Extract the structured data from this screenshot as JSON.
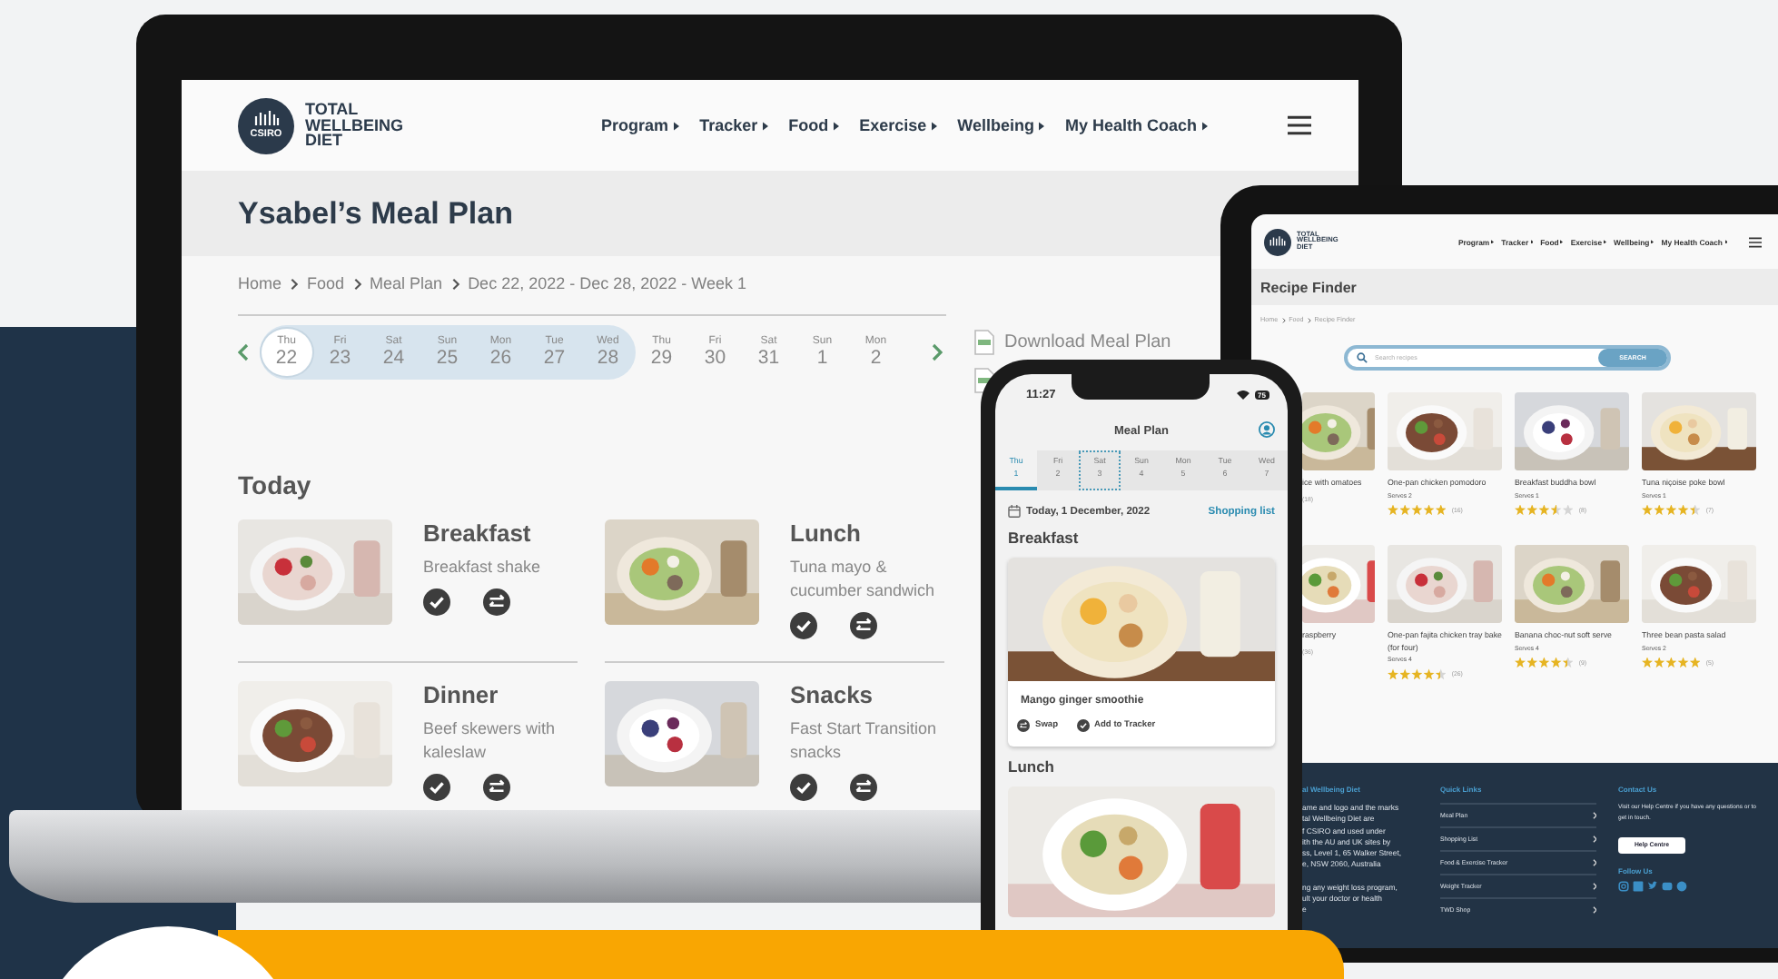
{
  "laptop": {
    "logo": {
      "badge": "CSIRO",
      "wordmark": [
        "TOTAL",
        "WELLBEING",
        "DIET"
      ]
    },
    "nav": [
      "Program",
      "Tracker",
      "Food",
      "Exercise",
      "Wellbeing",
      "My Health Coach"
    ],
    "title": "Ysabel’s Meal Plan",
    "breadcrumb": [
      "Home",
      "Food",
      "Meal Plan",
      "Dec 22, 2022 - Dec 28, 2022 - Week 1"
    ],
    "plan_week": [
      {
        "weekday": "Thu",
        "date": "22",
        "selected": true
      },
      {
        "weekday": "Fri",
        "date": "23",
        "selected": false
      },
      {
        "weekday": "Sat",
        "date": "24",
        "selected": false
      },
      {
        "weekday": "Sun",
        "date": "25",
        "selected": false
      },
      {
        "weekday": "Mon",
        "date": "26",
        "selected": false
      },
      {
        "weekday": "Tue",
        "date": "27",
        "selected": false
      },
      {
        "weekday": "Wed",
        "date": "28",
        "selected": false
      }
    ],
    "next_days": [
      {
        "weekday": "Thu",
        "date": "29",
        "selected": false
      },
      {
        "weekday": "Fri",
        "date": "30",
        "selected": false
      },
      {
        "weekday": "Sat",
        "date": "31",
        "selected": false
      },
      {
        "weekday": "Sun",
        "date": "1",
        "selected": false
      },
      {
        "weekday": "Mon",
        "date": "2",
        "selected": false
      }
    ],
    "download": "Download Meal Plan",
    "section": "Today",
    "meals": [
      {
        "name": "Breakfast",
        "description": "Breakfast shake"
      },
      {
        "name": "Lunch",
        "description": "Tuna mayo & cucumber sandwich"
      },
      {
        "name": "Dinner",
        "description": "Beef skewers with kaleslaw"
      },
      {
        "name": "Snacks",
        "description": "Fast Start Transition snacks"
      }
    ]
  },
  "tablet": {
    "logo": {
      "wordmark": [
        "TOTAL",
        "WELLBEING",
        "DIET"
      ]
    },
    "nav": [
      "Program",
      "Tracker",
      "Food",
      "Exercise",
      "Wellbeing",
      "My Health Coach"
    ],
    "title": "Recipe Finder",
    "breadcrumb": [
      "Home",
      "Food",
      "Recipe Finder"
    ],
    "search": {
      "placeholder": "Search recipes",
      "button": "SEARCH"
    },
    "recipes": [
      {
        "name": "ice with omatoes",
        "count": "(18)"
      },
      {
        "name": "One-pan chicken pomodoro",
        "serves": "Serves 2",
        "stars": 5,
        "count": "(16)"
      },
      {
        "name": "Breakfast buddha bowl",
        "serves": "Serves 1",
        "stars": 3.5,
        "count": "(8)"
      },
      {
        "name": "Tuna niçoise poke bowl",
        "serves": "Serves 1",
        "stars": 4.5,
        "count": "(7)"
      },
      {
        "name": "raspberry",
        "count": "(36)"
      },
      {
        "name": "One-pan fajita chicken tray bake (for four)",
        "serves": "Serves 4",
        "stars": 4.5,
        "count": "(26)"
      },
      {
        "name": "Banana choc-nut soft serve",
        "serves": "Serves 4",
        "stars": 4.5,
        "count": "(9)"
      },
      {
        "name": "Three bean pasta salad",
        "serves": "Serves 2",
        "stars": 5,
        "count": "(5)"
      }
    ],
    "footer": {
      "about": {
        "heading": "al Wellbeing Diet",
        "paragraphs": [
          [
            "ame and logo and the marks",
            "tal Wellbeing Diet are",
            "f CSIRO and used under",
            "ith the AU and UK sites by",
            "ss, Level 1, 65 Walker Street,",
            "e, NSW 2060, Australia"
          ],
          [
            "ng any weight loss program,",
            "ult your doctor or health",
            "e"
          ]
        ]
      },
      "quick_links": {
        "heading": "Quick Links",
        "items": [
          "Meal Plan",
          "Shopping List",
          "Food & Exercise Tracker",
          "Weight Tracker",
          "TWD Shop"
        ]
      },
      "contact": {
        "heading": "Contact Us",
        "text": "Visit our Help Centre if you have any questions or to get in touch.",
        "button": "Help Centre",
        "follow": "Follow Us"
      }
    }
  },
  "phone": {
    "time": "11:27",
    "battery": "75",
    "title": "Meal Plan",
    "days": [
      {
        "weekday": "Thu",
        "date": "1",
        "selected": true,
        "focused": false
      },
      {
        "weekday": "Fri",
        "date": "2",
        "selected": false,
        "focused": false
      },
      {
        "weekday": "Sat",
        "date": "3",
        "selected": false,
        "focused": true
      },
      {
        "weekday": "Sun",
        "date": "4",
        "selected": false,
        "focused": false
      },
      {
        "weekday": "Mon",
        "date": "5",
        "selected": false,
        "focused": false
      },
      {
        "weekday": "Tue",
        "date": "6",
        "selected": false,
        "focused": false
      },
      {
        "weekday": "Wed",
        "date": "7",
        "selected": false,
        "focused": false
      }
    ],
    "date_label": "Today, 1 December, 2022",
    "link": "Shopping list",
    "breakfast": {
      "heading": "Breakfast",
      "recipe": "Mango ginger smoothie",
      "actions": [
        {
          "kind": "swap",
          "label": "Swap"
        },
        {
          "kind": "add",
          "label": "Add to Tracker"
        }
      ]
    },
    "lunch": {
      "heading": "Lunch"
    }
  }
}
